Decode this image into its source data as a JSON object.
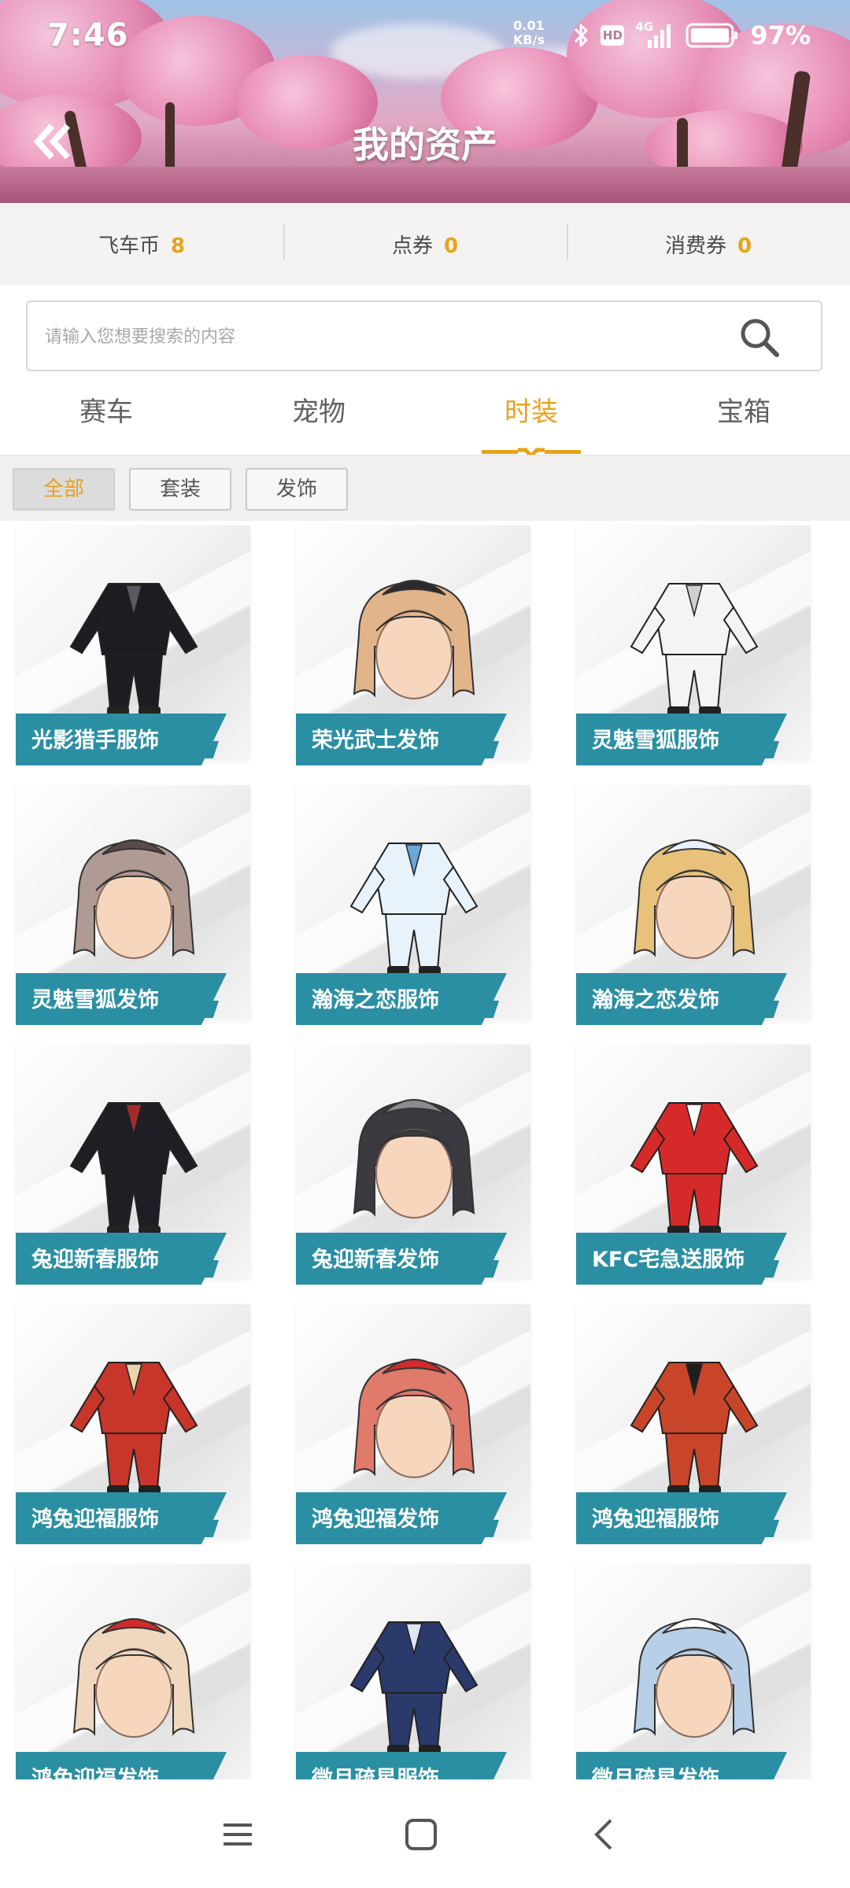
{
  "status_bar": {
    "time": "7:46",
    "net_speed_value": "0.01",
    "net_speed_unit": "KB/s",
    "network_type": "4G",
    "hd_label": "HD",
    "battery_percent": "97%"
  },
  "header": {
    "title": "我的资产",
    "back_icon": "double-chevron-left-icon"
  },
  "currencies": [
    {
      "label": "飞车币",
      "value": "8"
    },
    {
      "label": "点券",
      "value": "0"
    },
    {
      "label": "消费券",
      "value": "0"
    }
  ],
  "search": {
    "placeholder": "请输入您想要搜索的内容",
    "value": "",
    "icon": "search-icon"
  },
  "tabs": [
    {
      "label": "赛车",
      "active": false
    },
    {
      "label": "宠物",
      "active": false
    },
    {
      "label": "时装",
      "active": true
    },
    {
      "label": "宝箱",
      "active": false
    }
  ],
  "filters": [
    {
      "label": "全部",
      "active": true
    },
    {
      "label": "套装",
      "active": false
    },
    {
      "label": "发饰",
      "active": false
    }
  ],
  "items": [
    {
      "name": "光影猎手服饰",
      "kind": "outfit",
      "color": "#1c1c22",
      "accent": "#5a5a66"
    },
    {
      "name": "荣光武士发饰",
      "kind": "hair",
      "color": "#e2b48a",
      "accent": "#2a2a2a"
    },
    {
      "name": "灵魅雪狐服饰",
      "kind": "outfit",
      "color": "#f4f4f4",
      "accent": "#cfcfcf"
    },
    {
      "name": "灵魅雪狐发饰",
      "kind": "hair",
      "color": "#b09a94",
      "accent": "#5a4a48"
    },
    {
      "name": "瀚海之恋服饰",
      "kind": "outfit",
      "color": "#e8f2fb",
      "accent": "#6aa8dc"
    },
    {
      "name": "瀚海之恋发饰",
      "kind": "hair",
      "color": "#e8c27a",
      "accent": "#e9f2fb"
    },
    {
      "name": "兔迎新春服饰",
      "kind": "outfit",
      "color": "#1e1e24",
      "accent": "#a52a2a"
    },
    {
      "name": "兔迎新春发饰",
      "kind": "hair",
      "color": "#3a3a40",
      "accent": "#8a8a90"
    },
    {
      "name": "KFC宅急送服饰",
      "kind": "outfit",
      "color": "#d62a2a",
      "accent": "#ffffff"
    },
    {
      "name": "鸿兔迎福服饰",
      "kind": "outfit",
      "color": "#c8352a",
      "accent": "#e9d6a8"
    },
    {
      "name": "鸿兔迎福发饰",
      "kind": "hair",
      "color": "#e07a6a",
      "accent": "#d02a2a"
    },
    {
      "name": "鸿兔迎福服饰",
      "kind": "outfit",
      "color": "#c8452a",
      "accent": "#1e1e1e"
    },
    {
      "name": "鸿兔迎福发饰",
      "kind": "hair",
      "color": "#f0d8c0",
      "accent": "#d02a2a"
    },
    {
      "name": "微月疏星服饰",
      "kind": "outfit",
      "color": "#2a3a6a",
      "accent": "#dfe6f2"
    },
    {
      "name": "微月疏星发饰",
      "kind": "hair",
      "color": "#b8cfe8",
      "accent": "#ffffff"
    }
  ],
  "nav": {
    "menu_icon": "menu-icon",
    "home_icon": "home-square-icon",
    "back_icon": "back-chevron-icon"
  },
  "colors": {
    "accent": "#e8a21a",
    "label_bg": "#2a8fa3"
  }
}
